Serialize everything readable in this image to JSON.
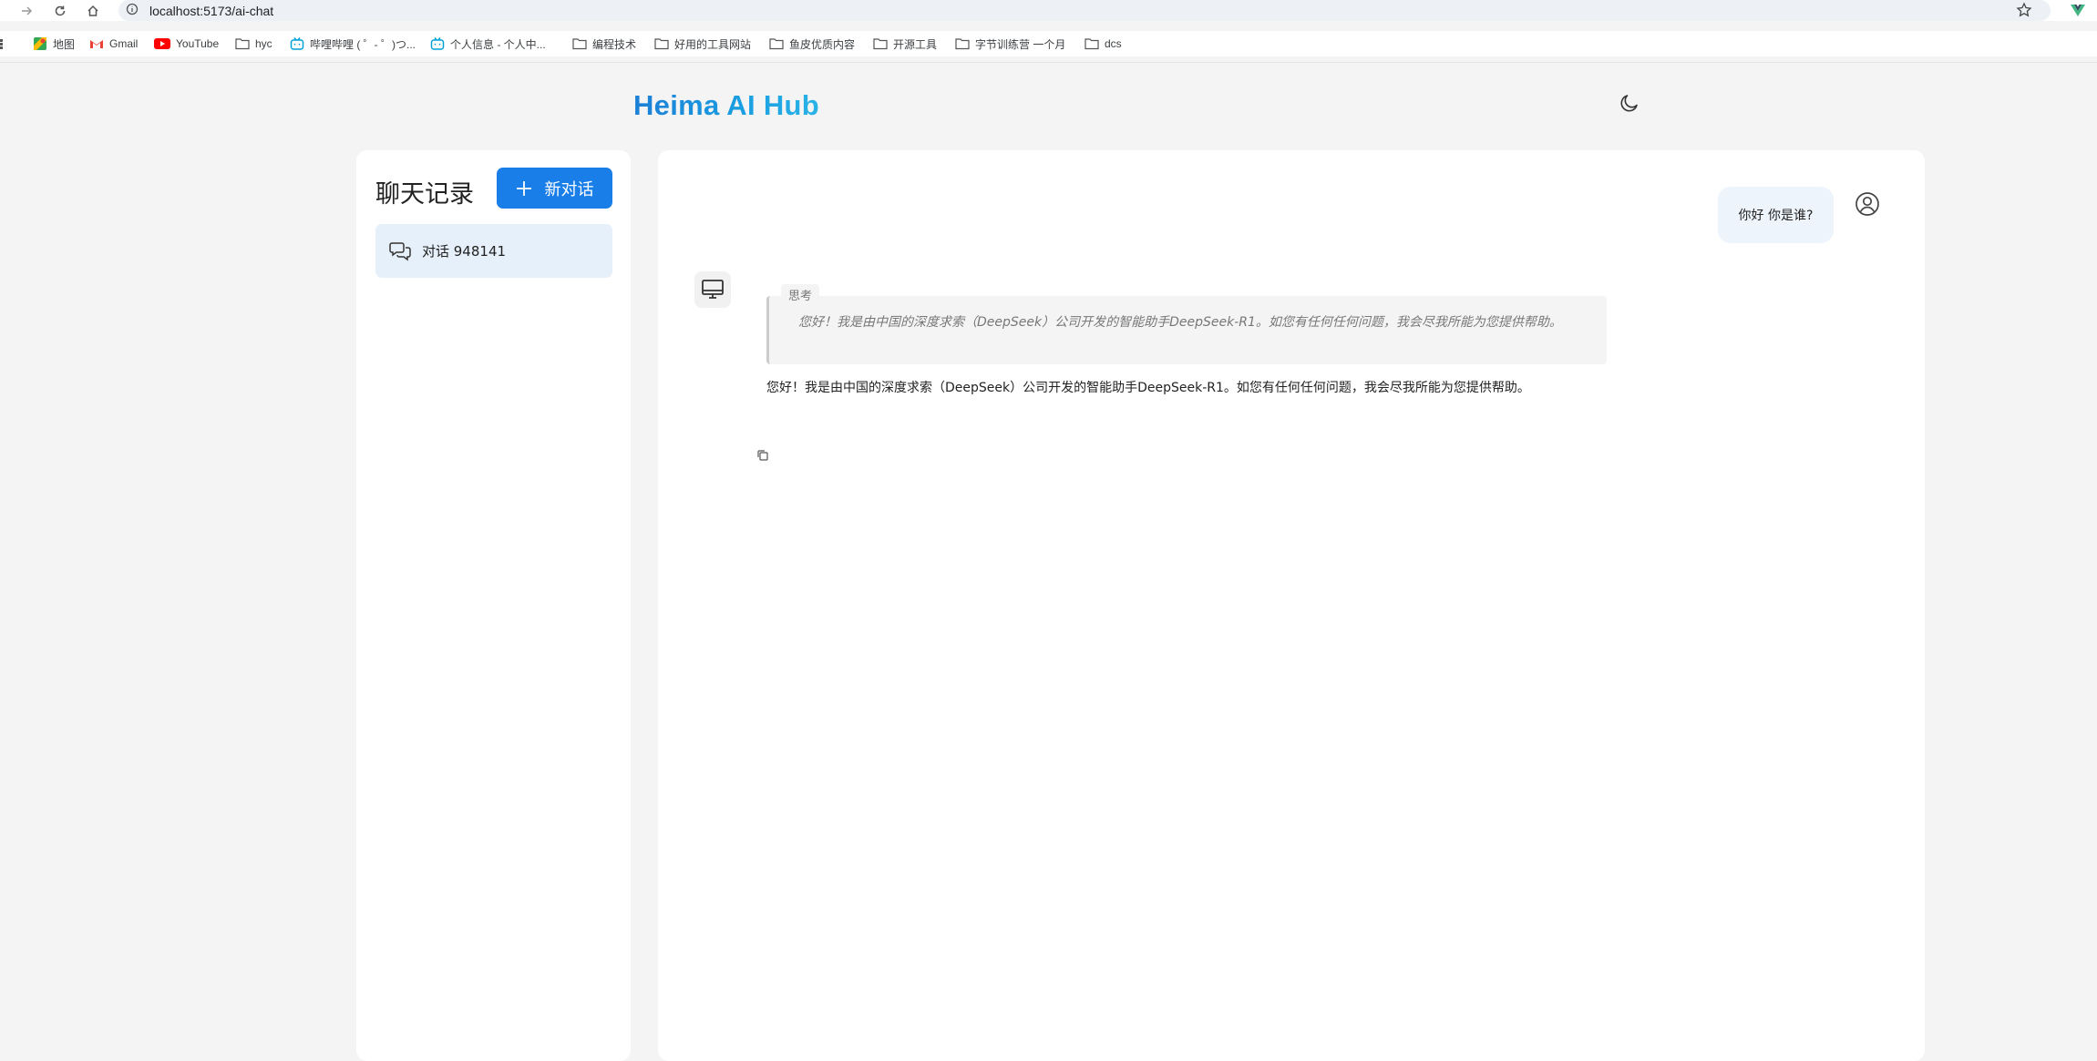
{
  "browser": {
    "url": "localhost:5173/ai-chat",
    "bookmarks": [
      {
        "label": "地图",
        "icon": "maps-icon"
      },
      {
        "label": "Gmail",
        "icon": "gmail-icon"
      },
      {
        "label": "YouTube",
        "icon": "youtube-icon"
      },
      {
        "label": "hyc",
        "icon": "folder-icon"
      },
      {
        "label": "哔哩哔哩 ( ゜- ゜)つ...",
        "icon": "bilibili-icon"
      },
      {
        "label": "个人信息 - 个人中...",
        "icon": "bilibili-icon"
      },
      {
        "label": "编程技术",
        "icon": "folder-icon"
      },
      {
        "label": "好用的工具网站",
        "icon": "folder-icon"
      },
      {
        "label": "鱼皮优质内容",
        "icon": "folder-icon"
      },
      {
        "label": "开源工具",
        "icon": "folder-icon"
      },
      {
        "label": "字节训练营 一个月",
        "icon": "folder-icon"
      },
      {
        "label": "dcs",
        "icon": "folder-icon"
      }
    ]
  },
  "header": {
    "brand": "Heima AI Hub",
    "theme_icon": "moon-icon"
  },
  "sidebar": {
    "title": "聊天记录",
    "new_chat_label": "新对话",
    "conversations": [
      {
        "label": "对话 948141",
        "active": true
      }
    ]
  },
  "chat": {
    "user_message": "你好 你是谁?",
    "think_label": "思考",
    "think_text": "您好！我是由中国的深度求索（DeepSeek）公司开发的智能助手DeepSeek-R1。如您有任何任何问题，我会尽我所能为您提供帮助。",
    "answer_text": "您好！我是由中国的深度求索（DeepSeek）公司开发的智能助手DeepSeek-R1。如您有任何任何问题，我会尽我所能为您提供帮助。"
  },
  "colors": {
    "accent": "#1a7ee8",
    "brand_gradient_start": "#1b7fd6",
    "brand_gradient_end": "#2ab3e6",
    "active_conversation_bg": "#e6f0fa"
  }
}
